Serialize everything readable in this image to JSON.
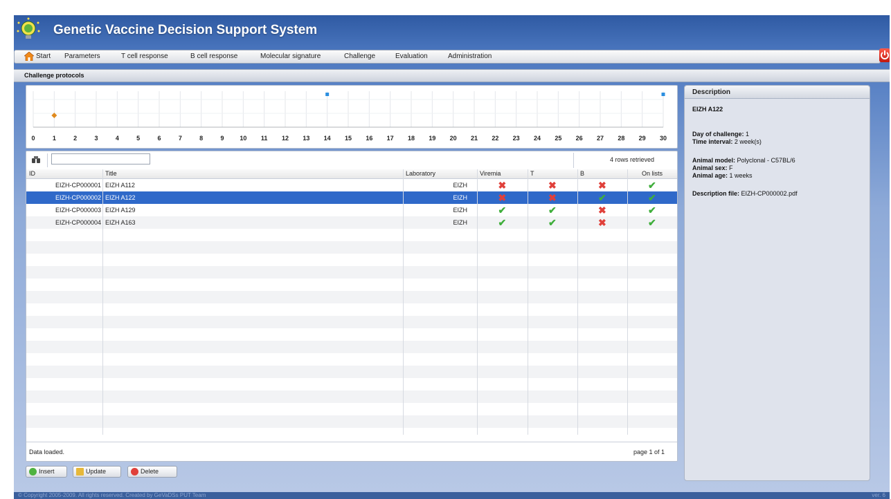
{
  "app": {
    "title": "Genetic Vaccine Decision Support System",
    "copyright": "© Copyright 2005-2009. All rights reserved. Created by GeVaDSs PUT Team",
    "version": "ver. 6"
  },
  "menu": [
    "Start",
    "Parameters",
    "T cell response",
    "B cell response",
    "Molecular signature",
    "Challenge",
    "Evaluation",
    "Administration"
  ],
  "section": {
    "title": "Challenge protocols"
  },
  "timeline": {
    "ticks": [
      "0",
      "1",
      "2",
      "3",
      "4",
      "5",
      "6",
      "7",
      "8",
      "9",
      "10",
      "11",
      "12",
      "13",
      "14",
      "15",
      "16",
      "17",
      "18",
      "19",
      "20",
      "21",
      "22",
      "23",
      "24",
      "25",
      "26",
      "27",
      "28",
      "29",
      "30"
    ],
    "markers": [
      {
        "x": 1,
        "kind": "diamond",
        "color": "#e08a1e"
      },
      {
        "x": 14,
        "kind": "square",
        "color": "#2b8fe0"
      },
      {
        "x": 30,
        "kind": "square",
        "color": "#2b8fe0"
      }
    ]
  },
  "grid": {
    "search_value": "",
    "rows_retrieved": "4 rows retrieved",
    "columns": [
      "ID",
      "Title",
      "Laboratory",
      "Viremia",
      "T",
      "B",
      "On lists"
    ],
    "rows": [
      {
        "id": "EIZH-CP000001",
        "title": "EIZH A112",
        "lab": "EIZH",
        "viremia": "x",
        "t": "x",
        "b": "x",
        "on_lists": "ok"
      },
      {
        "id": "EIZH-CP000002",
        "title": "EIZH A122",
        "lab": "EIZH",
        "viremia": "x",
        "t": "x",
        "b": "ok",
        "on_lists": "ok"
      },
      {
        "id": "EIZH-CP000003",
        "title": "EIZH A129",
        "lab": "EIZH",
        "viremia": "ok",
        "t": "ok",
        "b": "x",
        "on_lists": "ok"
      },
      {
        "id": "EIZH-CP000004",
        "title": "EIZH A163",
        "lab": "EIZH",
        "viremia": "ok",
        "t": "ok",
        "b": "x",
        "on_lists": "ok"
      }
    ],
    "selected_row": "EIZH-CP000002",
    "status": "Data loaded.",
    "page": "page 1 of 1"
  },
  "buttons": {
    "insert": "Insert",
    "update": "Update",
    "delete": "Delete"
  },
  "description": {
    "header": "Description",
    "name": "EIZH A122",
    "day_label": "Day of challenge:",
    "day_value": "1",
    "interval_label": "Time interval:",
    "interval_value": "2 week(s)",
    "model_label": "Animal model:",
    "model_value": "Polyclonal - C57BL/6",
    "sex_label": "Animal sex:",
    "sex_value": "F",
    "age_label": "Animal age:",
    "age_value": "1 weeks",
    "file_label": "Description file:",
    "file_value": "EIZH-CP000002.pdf"
  },
  "colors": {
    "accent": "#2f69c9",
    "check": "#3fae3b",
    "cross": "#e0403a"
  }
}
